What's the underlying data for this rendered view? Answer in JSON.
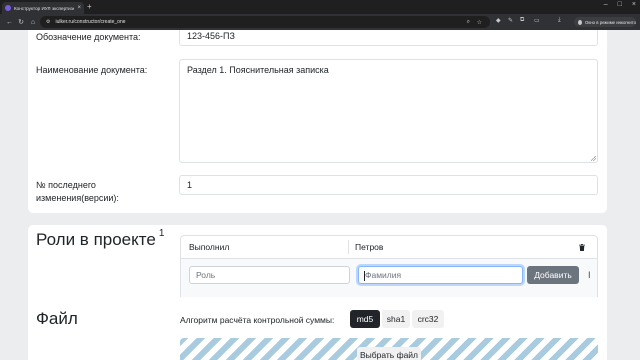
{
  "browser": {
    "tab_title": "Конструктор ИУЛ экспертизн…",
    "url": "iulker.ru/constructor/create_one",
    "incognito_label": "Окно в режиме инкогнито"
  },
  "document_card": {
    "designation_label": "Обозначение документа:",
    "designation_value": "123-456-ПЗ",
    "name_label": "Наименование документа:",
    "name_value": "Раздел 1. Пояснительная записка",
    "revision_label_line1": "№ последнего",
    "revision_label_line2": "изменения(версии):",
    "revision_value": "1"
  },
  "roles_section": {
    "title": "Роли в проекте",
    "count": "1",
    "rows": [
      {
        "role": "Выполнил",
        "surname": "Петров"
      }
    ],
    "role_placeholder": "Роль",
    "surname_placeholder": "Фамилия",
    "add_button": "Добавить"
  },
  "file_section": {
    "title": "Файл",
    "algo_label": "Алгоритм расчёта контрольной суммы:",
    "algorithms": [
      "md5",
      "sha1",
      "crc32"
    ],
    "selected_algorithm": "md5",
    "choose_button": "Выбрать файл"
  }
}
